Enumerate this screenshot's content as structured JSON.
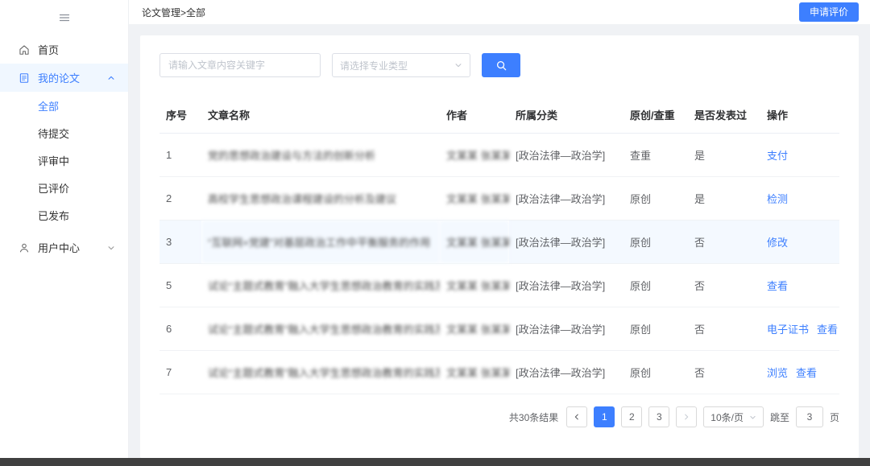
{
  "colors": {
    "accent": "#3d7fff",
    "row_highlight": "#f4f9ff",
    "footer": "#404040"
  },
  "sidebar": {
    "items": {
      "home": "首页",
      "my_papers": "我的论文",
      "all": "全部",
      "to_submit": "待提交",
      "in_review": "评审中",
      "evaluated": "已评价",
      "published": "已发布",
      "user_center": "用户中心"
    }
  },
  "header": {
    "breadcrumb": "论文管理>全部",
    "apply_button": "申请评价"
  },
  "filters": {
    "keyword_placeholder": "请输入文章内容关键字",
    "category_placeholder": "请选择专业类型"
  },
  "table": {
    "columns": [
      "序号",
      "文章名称",
      "作者",
      "所属分类",
      "原创/查重",
      "是否发表过",
      "操作"
    ],
    "rows": [
      {
        "no": "1",
        "title": "党的思想政治建设与方法的创新分析",
        "author": "文某某 张某某",
        "category": "[政治法律—政治学]",
        "originality": "查重",
        "published": "是",
        "actions": [
          "支付"
        ]
      },
      {
        "no": "2",
        "title": "高校学生思想政治课程建设的分析及建议",
        "author": "文某某 张某某",
        "category": "[政治法律—政治学]",
        "originality": "原创",
        "published": "是",
        "actions": [
          "检测"
        ]
      },
      {
        "no": "3",
        "title": "“互联网+党建”对基层政治工作中平衡服务的作用",
        "author": "文某某 张某某",
        "category": "[政治法律—政治学]",
        "originality": "原创",
        "published": "否",
        "actions": [
          "修改"
        ]
      },
      {
        "no": "5",
        "title": "试论“主题式教育”融入大学生思想政治教育的实践及路径",
        "author": "文某某 张某某",
        "category": "[政治法律—政治学]",
        "originality": "原创",
        "published": "否",
        "actions": [
          "查看"
        ]
      },
      {
        "no": "6",
        "title": "试论“主题式教育”融入大学生思想政治教育的实践及路径",
        "author": "文某某 张某某",
        "category": "[政治法律—政治学]",
        "originality": "原创",
        "published": "否",
        "actions": [
          "电子证书",
          "查看"
        ]
      },
      {
        "no": "7",
        "title": "试论“主题式教育”融入大学生思想政治教育的实践及路径",
        "author": "文某某 张某某",
        "category": "[政治法律—政治学]",
        "originality": "原创",
        "published": "否",
        "actions": [
          "浏览",
          "查看"
        ]
      }
    ]
  },
  "pagination": {
    "total": "共30条结果",
    "pages": [
      "1",
      "2",
      "3"
    ],
    "active_page": "1",
    "page_size": "10条/页",
    "jump_label": "跳至",
    "jump_value": "3",
    "jump_suffix": "页"
  }
}
